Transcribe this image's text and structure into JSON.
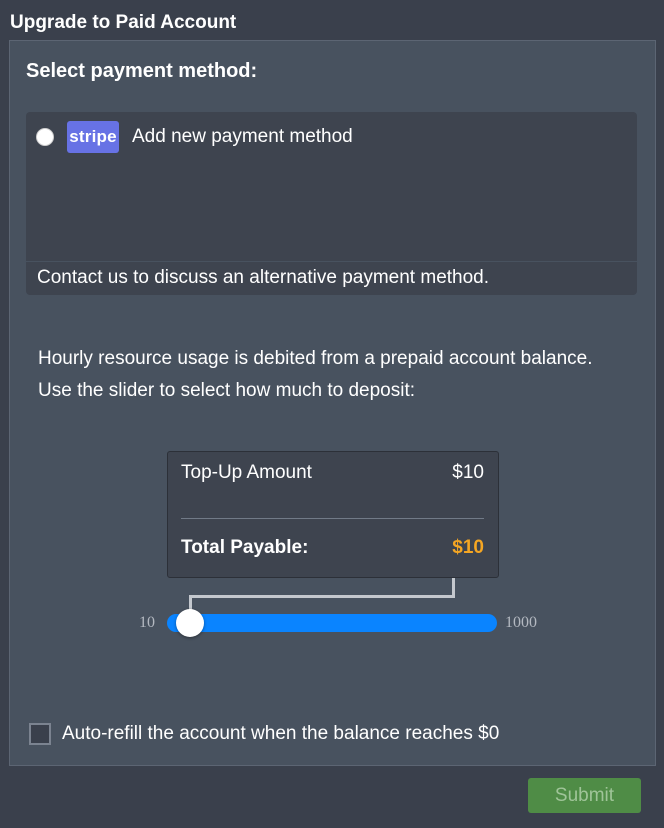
{
  "dialog": {
    "title": "Upgrade to Paid Account"
  },
  "payment": {
    "section_title": "Select payment method:",
    "stripe_badge": "stripe",
    "add_method_label": "Add new payment method",
    "contact_text": "Contact us to discuss an alternative payment method."
  },
  "info": {
    "line1": "Hourly resource usage is debited from a prepaid account balance.",
    "line2": "Use the slider to select how much to deposit:"
  },
  "summary": {
    "topup_label": "Top-Up Amount",
    "topup_value": "$10",
    "total_label": "Total Payable:",
    "total_value": "$10"
  },
  "slider": {
    "min_label": "10",
    "max_label": "1000",
    "min": 10,
    "max": 1000,
    "value": 10
  },
  "autorefill": {
    "label": "Auto-refill the account when the balance reaches $0",
    "checked": false
  },
  "actions": {
    "submit_label": "Submit"
  },
  "colors": {
    "accent": "#0a84ff",
    "total": "#f5a623",
    "submit": "#4f8c46",
    "stripe": "#6772e5"
  }
}
